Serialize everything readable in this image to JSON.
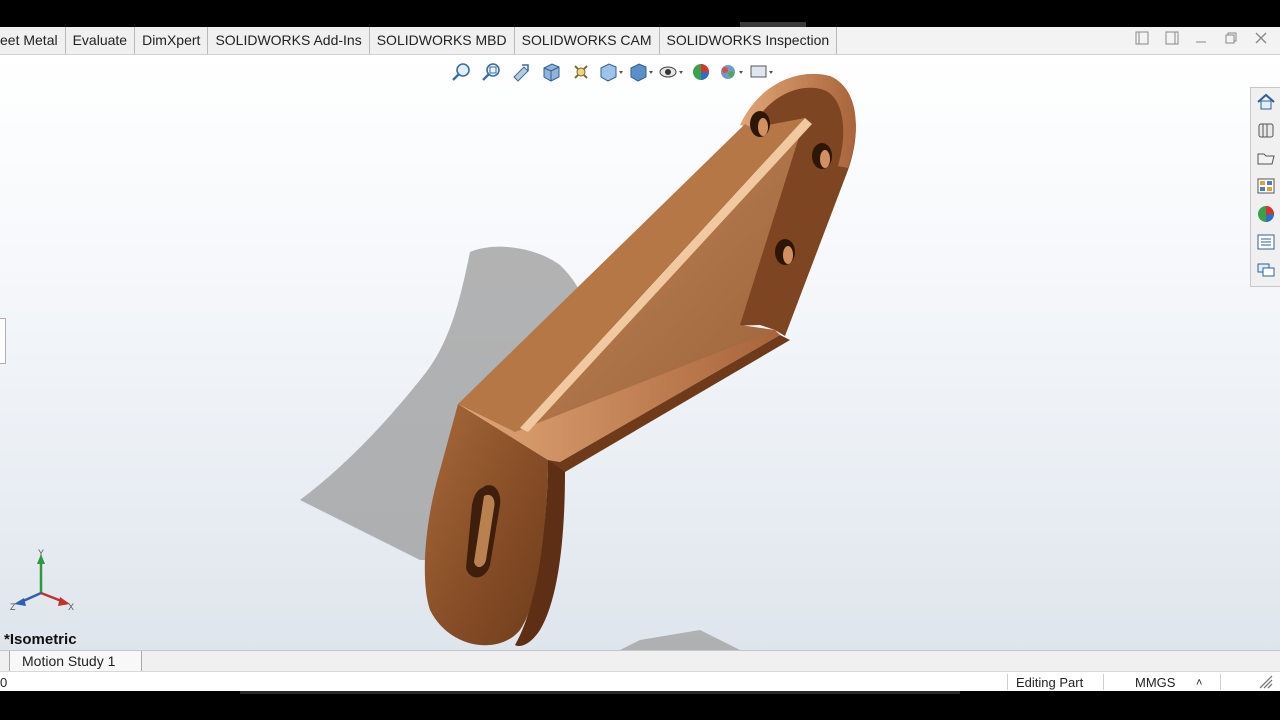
{
  "command_manager": {
    "tabs": [
      {
        "label": "eet Metal"
      },
      {
        "label": "Evaluate"
      },
      {
        "label": "DimXpert"
      },
      {
        "label": "SOLIDWORKS Add-Ins"
      },
      {
        "label": "SOLIDWORKS MBD"
      },
      {
        "label": "SOLIDWORKS CAM"
      },
      {
        "label": "SOLIDWORKS Inspection"
      }
    ]
  },
  "window_controls": [
    "restore-left-icon",
    "restore-right-icon",
    "minimize-icon",
    "maximize-icon",
    "close-icon"
  ],
  "heads_up_toolbar": [
    "zoom-to-fit-icon",
    "zoom-to-area-icon",
    "previous-view-icon",
    "section-view-icon",
    "dynamic-annotation-icon",
    "view-orientation-icon",
    "display-style-icon",
    "hide-show-items-icon",
    "edit-appearance-icon",
    "apply-scene-icon",
    "view-settings-icon"
  ],
  "task_pane": [
    "solidworks-resources-icon",
    "design-library-icon",
    "file-explorer-icon",
    "view-palette-icon",
    "appearances-icon",
    "custom-properties-icon",
    "forum-icon"
  ],
  "viewport": {
    "view_name": "*Isometric",
    "triad": {
      "x": "X",
      "y": "Y",
      "z": "Z"
    },
    "model_color": "#8a5028",
    "background_top": "#ffffff",
    "background_bottom": "#dfe5ec"
  },
  "motion_bar": {
    "study_tab": "Motion Study 1"
  },
  "status_bar": {
    "left_text": "0",
    "editing": "Editing Part",
    "units": "MMGS",
    "units_arrow": "˄"
  }
}
